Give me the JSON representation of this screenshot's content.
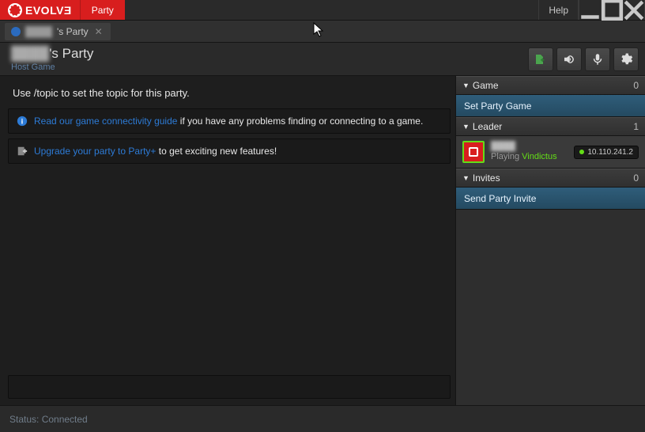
{
  "brand": {
    "text": "EVOLVƎ"
  },
  "titlebar": {
    "party_tab": "Party",
    "help": "Help"
  },
  "tabbar": {
    "party_suffix": "'s Party",
    "close": "✕"
  },
  "header": {
    "title_prefix_redacted": "████",
    "title_suffix": "'s Party",
    "host_game": "Host Game"
  },
  "chat": {
    "topic_hint": "Use /topic to set the topic for this party.",
    "msg1_link": "Read our game connectivity guide",
    "msg1_rest": " if you have any problems finding or connecting to a game.",
    "msg2_link": "Upgrade your party to Party+",
    "msg2_rest": " to get exciting new features!"
  },
  "side": {
    "game": {
      "label": "Game",
      "count": "0",
      "action": "Set Party Game"
    },
    "leader": {
      "label": "Leader",
      "count": "1",
      "playing_prefix": "Playing ",
      "playing_game": "Vindictus",
      "ip": "10.110.241.2"
    },
    "invites": {
      "label": "Invites",
      "count": "0",
      "action": "Send Party Invite"
    }
  },
  "status": {
    "text": "Status: Connected"
  }
}
